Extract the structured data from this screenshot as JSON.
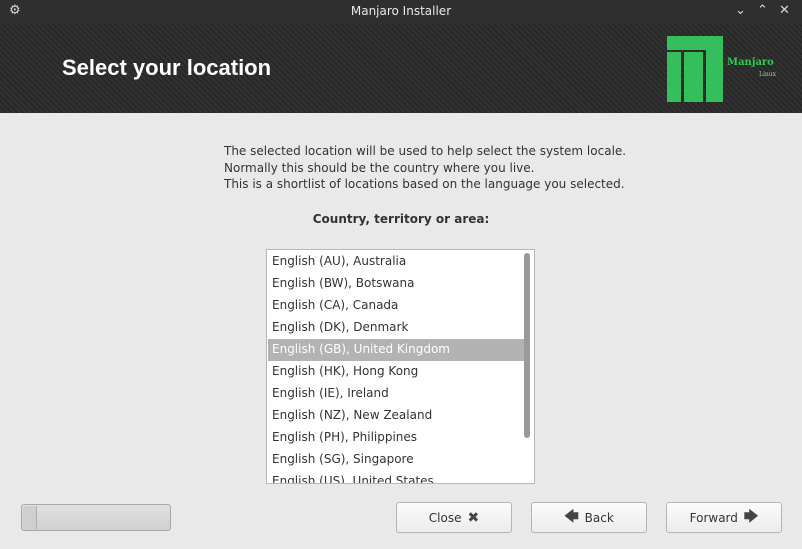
{
  "window": {
    "title": "Manjaro Installer",
    "menu_icon": "gear-icon",
    "minimize_icon": "minimize-icon",
    "close_icon": "close-icon"
  },
  "header": {
    "heading": "Select your location",
    "logo": {
      "name": "Manjaro",
      "subtitle": "Linux",
      "color": "#35bf5c"
    }
  },
  "intro": {
    "lines": [
      "The selected location will be used to help select the system locale.",
      "Normally this should be the country where you live.",
      "This is a shortlist of locations based on the language you selected."
    ]
  },
  "location": {
    "label": "Country, territory or area:",
    "items": [
      "English (AU), Australia",
      "English (BW), Botswana",
      "English (CA), Canada",
      "English (DK), Denmark",
      "English (GB), United Kingdom",
      "English (HK), Hong Kong",
      "English (IE), Ireland",
      "English (NZ), New Zealand",
      "English (PH), Philippines",
      "English (SG), Singapore",
      "English (US), United States"
    ],
    "selected": "English (GB), United Kingdom"
  },
  "footer": {
    "progress_fraction": 0.09,
    "close_label": "Close",
    "close_icon": "close-x-icon",
    "back_label": "Back",
    "back_icon": "arrow-left-icon",
    "forward_label": "Forward",
    "forward_icon": "arrow-right-icon"
  }
}
